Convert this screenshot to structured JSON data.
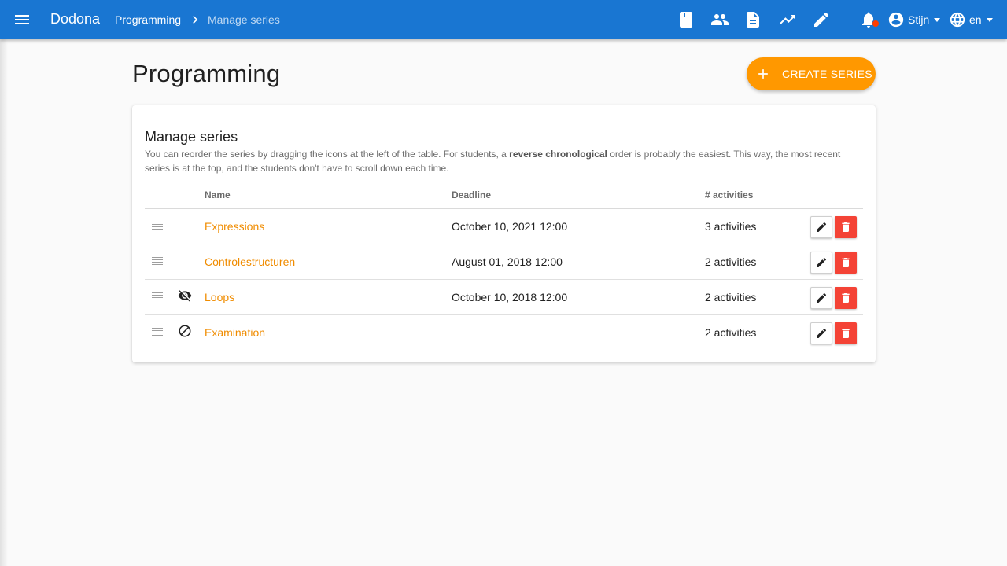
{
  "header": {
    "brand": "Dodona",
    "breadcrumb": [
      "Programming",
      "Manage series"
    ],
    "user": "Stijn",
    "language": "en",
    "bar_color": "#1976d2"
  },
  "page": {
    "title": "Programming",
    "create_button": "CREATE SERIES",
    "accent": "#ff9800"
  },
  "card": {
    "title": "Manage series",
    "description_before": "You can reorder the series by dragging the icons at the left of the table. For students, a ",
    "description_bold": "reverse chronological",
    "description_after": " order is probably the easiest. This way, the most recent series is at the top, and the students don't have to scroll down each time."
  },
  "table": {
    "columns": [
      "Name",
      "Deadline",
      "# activities"
    ],
    "rows": [
      {
        "name": "Expressions",
        "deadline": "October 10, 2021 12:00",
        "activities": "3 activities",
        "status_icon": ""
      },
      {
        "name": "Controlestructuren",
        "deadline": "August 01, 2018 12:00",
        "activities": "2 activities",
        "status_icon": ""
      },
      {
        "name": "Loops",
        "deadline": "October 10, 2018 12:00",
        "activities": "2 activities",
        "status_icon": "eye-off-icon"
      },
      {
        "name": "Examination",
        "deadline": "",
        "activities": "2 activities",
        "status_icon": "block-icon"
      }
    ]
  }
}
